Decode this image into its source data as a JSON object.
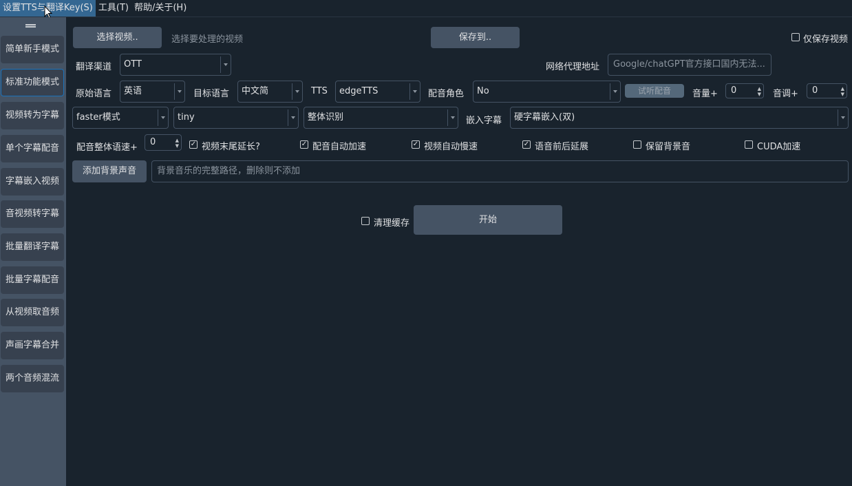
{
  "menu": {
    "settings": "设置TTS与翻译Key(S)",
    "tools": "工具(T)",
    "help": "帮助/关于(H)"
  },
  "sidebar": {
    "items": [
      "简单新手模式",
      "标准功能模式",
      "视频转为字幕",
      "单个字幕配音",
      "字幕嵌入视频",
      "音视频转字幕",
      "批量翻译字幕",
      "批量字幕配音",
      "从视频取音频",
      "声画字幕合并",
      "两个音频混流"
    ],
    "active_index": 1
  },
  "top": {
    "select_video_button": "选择视频..",
    "select_video_hint": "选择要处理的视频",
    "save_to_button": "保存到..",
    "only_save_video_label": "仅保存视频",
    "only_save_video_checked": false
  },
  "row1": {
    "translate_channel_label": "翻译渠道",
    "translate_channel_value": "OTT",
    "proxy_label": "网络代理地址",
    "proxy_placeholder": "Google/chatGPT官方接口国内无法..."
  },
  "row2": {
    "source_lang_label": "原始语言",
    "source_lang_value": "英语",
    "target_lang_label": "目标语言",
    "target_lang_value": "中文简",
    "tts_label": "TTS",
    "tts_value": "edgeTTS",
    "voice_role_label": "配音角色",
    "voice_role_value": "No",
    "listen_button": "试听配音",
    "volume_label": "音量+",
    "volume_value": "0",
    "pitch_label": "音调+",
    "pitch_value": "0"
  },
  "row3": {
    "whisper_mode_value": "faster模式",
    "model_value": "tiny",
    "recog_value": "整体识别",
    "embed_sub_label": "嵌入字幕",
    "embed_sub_value": "硬字幕嵌入(双)"
  },
  "row4": {
    "speed_label": "配音整体语速+",
    "speed_value": "0",
    "options": [
      {
        "label": "视频末尾延长?",
        "checked": true
      },
      {
        "label": "配音自动加速",
        "checked": true
      },
      {
        "label": "视频自动慢速",
        "checked": true
      },
      {
        "label": "语音前后延展",
        "checked": true
      },
      {
        "label": "保留背景音",
        "checked": false
      },
      {
        "label": "CUDA加速",
        "checked": false
      }
    ]
  },
  "row5": {
    "add_bg_button": "添加背景声音",
    "bg_placeholder": "背景音乐的完整路径，删除则不添加"
  },
  "bottom": {
    "clear_cache_label": "清理缓存",
    "clear_cache_checked": false,
    "start_button": "开始"
  }
}
